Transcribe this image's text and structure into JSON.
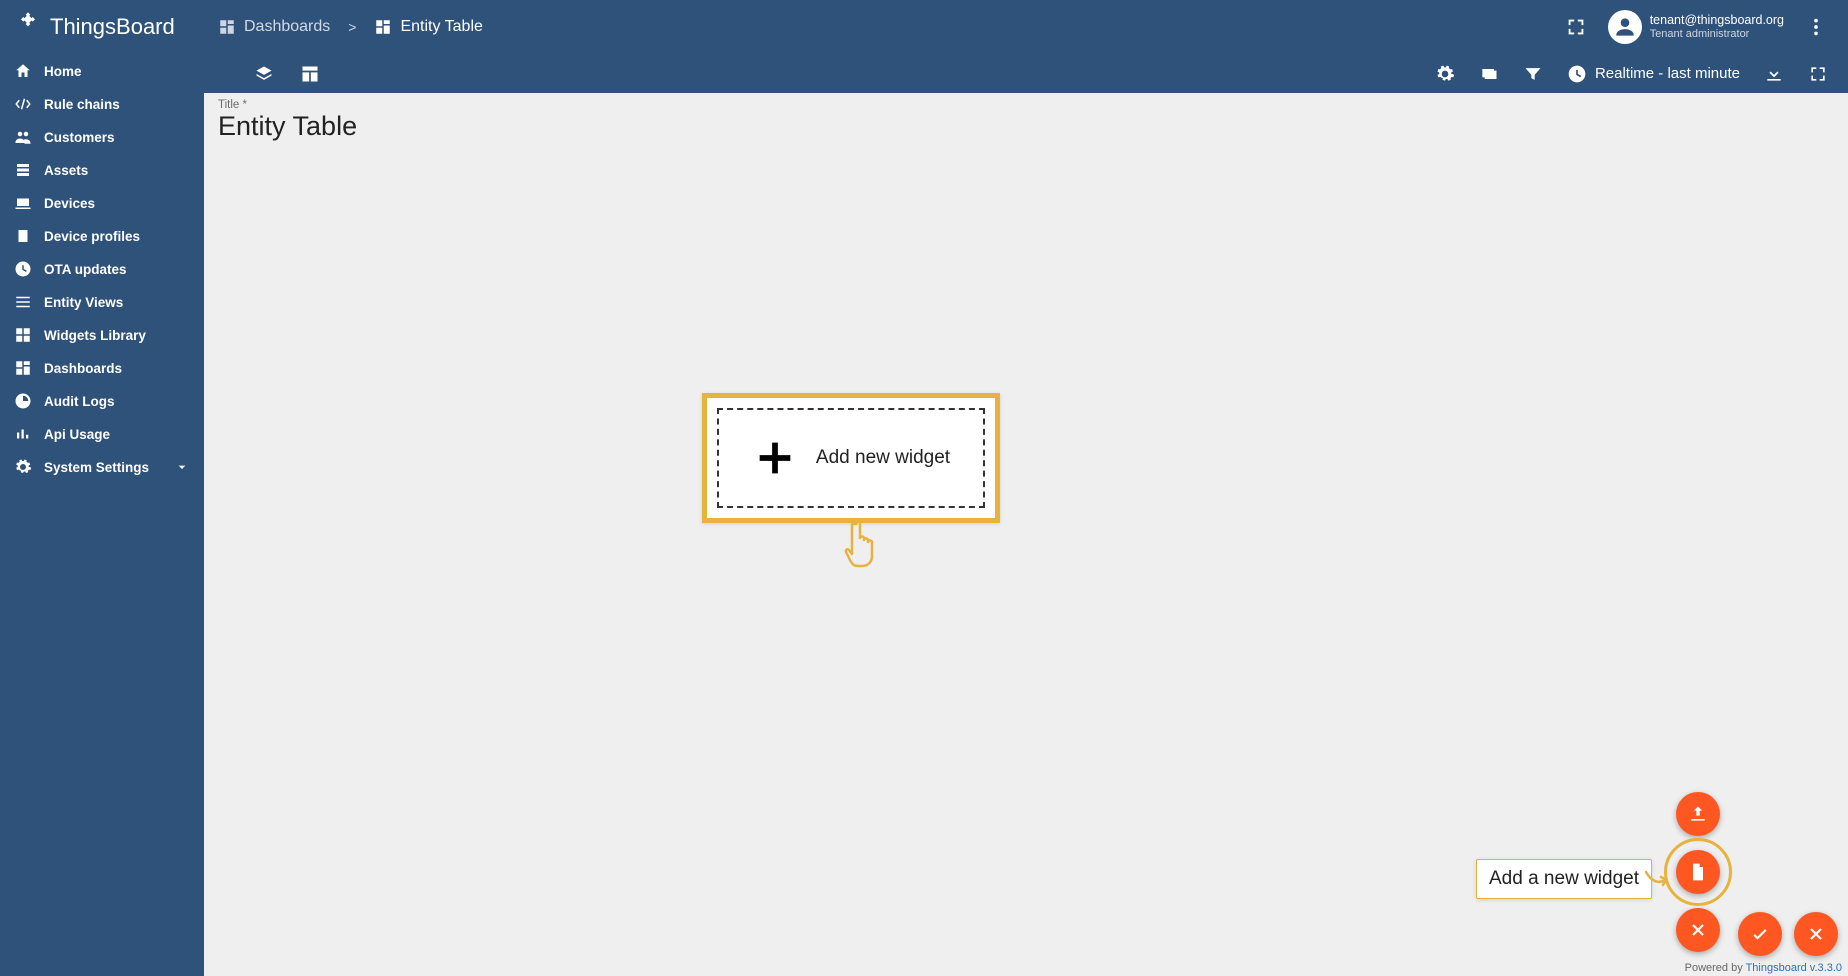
{
  "brand": "ThingsBoard",
  "breadcrumbs": {
    "root": "Dashboards",
    "sep": ">",
    "current": "Entity Table"
  },
  "user": {
    "email": "tenant@thingsboard.org",
    "role": "Tenant administrator"
  },
  "sidebar": {
    "items": [
      {
        "label": "Home"
      },
      {
        "label": "Rule chains"
      },
      {
        "label": "Customers"
      },
      {
        "label": "Assets"
      },
      {
        "label": "Devices"
      },
      {
        "label": "Device profiles"
      },
      {
        "label": "OTA updates"
      },
      {
        "label": "Entity Views"
      },
      {
        "label": "Widgets Library"
      },
      {
        "label": "Dashboards"
      },
      {
        "label": "Audit Logs"
      },
      {
        "label": "Api Usage"
      },
      {
        "label": "System Settings"
      }
    ]
  },
  "toolbar": {
    "time_window": "Realtime - last minute"
  },
  "dashboard": {
    "title_label": "Title *",
    "title_value": "Entity Table",
    "add_widget_label": "Add new widget"
  },
  "tooltip": {
    "add_widget": "Add a new widget"
  },
  "footer": {
    "prefix": "Powered by ",
    "link": "Thingsboard v.3.3.0"
  }
}
